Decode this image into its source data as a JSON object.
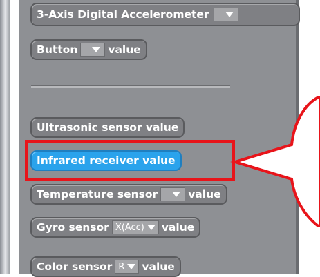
{
  "blocks": {
    "accelerometer": {
      "label": "3-Axis Digital Accelerometer"
    },
    "button": {
      "label": "Button",
      "suffix": "value"
    },
    "ultrasonic": {
      "label": "Ultrasonic sensor value"
    },
    "infrared": {
      "label": "Infrared receiver value"
    },
    "temperature": {
      "label": "Temperature sensor",
      "suffix": "value"
    },
    "gyro": {
      "label": "Gyro sensor",
      "option": "X(Acc)",
      "suffix": "value"
    },
    "color": {
      "label": "Color sensor",
      "option": "R",
      "suffix": "value"
    }
  },
  "colors": {
    "palette_bg": "#8e9094",
    "block_gray": "#7f8084",
    "block_active": "#2aa3ec",
    "highlight_red": "#e8141a"
  },
  "icons": {
    "dropdown": "dropdown-arrow-icon",
    "callout": "speech-callout-icon"
  }
}
